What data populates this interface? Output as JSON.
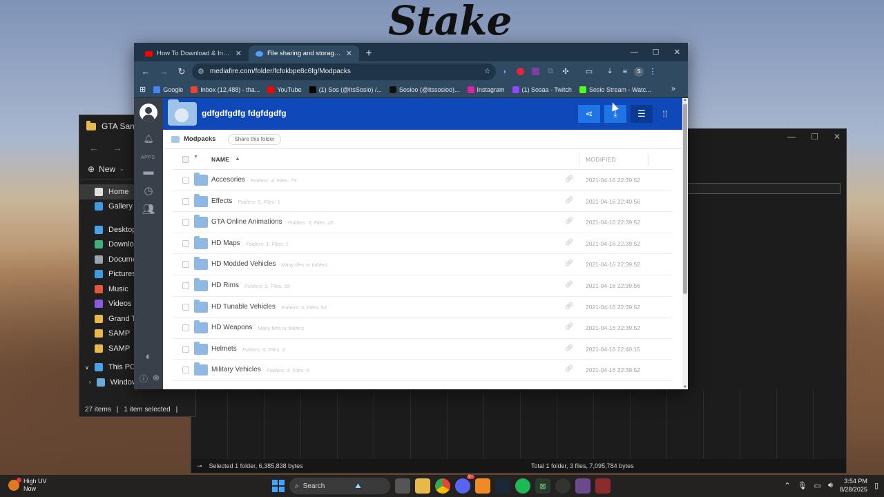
{
  "desktop": {
    "brand_logo": "Stake"
  },
  "explorer": {
    "title": "GTA San Andr",
    "new_label": "New",
    "nav_items": [
      {
        "label": "Home",
        "icon": "home-icon",
        "color": "#e0e0e0",
        "active": true
      },
      {
        "label": "Gallery",
        "icon": "gallery-icon",
        "color": "#3f9be0",
        "active": false
      },
      {
        "label": "Desktop",
        "icon": "desktop-icon",
        "color": "#4aa3e6",
        "active": false
      },
      {
        "label": "Downloads",
        "icon": "downloads-icon",
        "color": "#3fb07a",
        "active": false
      },
      {
        "label": "Documents",
        "icon": "documents-icon",
        "color": "#9aa4ad",
        "active": false
      },
      {
        "label": "Pictures",
        "icon": "pictures-icon",
        "color": "#3f9be0",
        "active": false
      },
      {
        "label": "Music",
        "icon": "music-icon",
        "color": "#e2563e",
        "active": false
      },
      {
        "label": "Videos",
        "icon": "videos-icon",
        "color": "#8a5be0",
        "active": false
      },
      {
        "label": "Grand Theft",
        "icon": "folder-icon",
        "color": "#e8b84a",
        "active": false
      },
      {
        "label": "SAMP",
        "icon": "folder-icon",
        "color": "#e8b84a",
        "active": false
      },
      {
        "label": "SAMP",
        "icon": "folder-icon",
        "color": "#e8b84a",
        "active": false
      }
    ],
    "this_pc": "This PC",
    "drive": "Windows (C:)",
    "status_items": "27 items",
    "status_selected": "1 item selected"
  },
  "darkapp": {
    "status_left": "Selected 1 folder, 6,385,838 bytes",
    "status_right": "Total 1 folder, 3 files, 7,095,784 bytes"
  },
  "browser": {
    "tabs": [
      {
        "label": "How To Download & Install Mods",
        "icon": "youtube-icon",
        "active": false
      },
      {
        "label": "File sharing and storage made simple",
        "icon": "mediafire-icon",
        "active": true
      }
    ],
    "url": "mediafire.com/folder/fcfokbpe8c6fg/Modpacks",
    "bookmarks": [
      {
        "label": "Google",
        "color": "#4285f4"
      },
      {
        "label": "Inbox (12,488) - tha...",
        "color": "#ea4335"
      },
      {
        "label": "YouTube",
        "color": "#ff0000"
      },
      {
        "label": "(1) Sos (@ItsSosio) /...",
        "color": "#000000"
      },
      {
        "label": "Sosioo (@itssosioo)...",
        "color": "#111111"
      },
      {
        "label": "Instagram",
        "color": "#d6249f"
      },
      {
        "label": "(1) Sosaa - Twitch",
        "color": "#9146ff"
      },
      {
        "label": "Sosio Stream - Watc...",
        "color": "#53fc18"
      }
    ]
  },
  "mediafire": {
    "folder_title": "gdfgdfgdfg fdgfdgdfg",
    "rail_apps_label": "APPS",
    "breadcrumb": "Modpacks",
    "share_folder": "Share this folder",
    "columns": {
      "name": "NAME",
      "modified": "MODIFIED"
    },
    "rows": [
      {
        "name": "Accesories",
        "meta": "Folders: 4, Files: 75",
        "date": "2021-04-16 22:39:52"
      },
      {
        "name": "Effects",
        "meta": "Folders: 0, Files: 1",
        "date": "2021-04-16 22:40:56"
      },
      {
        "name": "GTA Online Animations",
        "meta": "Folders: 3, Files: 26",
        "date": "2021-04-16 22:39:52"
      },
      {
        "name": "HD Maps",
        "meta": "Folders: 1, Files: 1",
        "date": "2021-04-16 22:39:52"
      },
      {
        "name": "HD Modded Vehicles",
        "meta": "Many files or folders",
        "date": "2021-04-16 22:39:52"
      },
      {
        "name": "HD Rims",
        "meta": "Folders: 1, Files: 39",
        "date": "2021-04-16 22:39:56"
      },
      {
        "name": "HD Tunable Vehicles",
        "meta": "Folders: 5, Files: 93",
        "date": "2021-04-16 22:39:52"
      },
      {
        "name": "HD Weapons",
        "meta": "Many files or folders",
        "date": "2021-04-16 22:39:52"
      },
      {
        "name": "Helmets",
        "meta": "Folders: 0, Files: 2",
        "date": "2021-04-16 22:40:15"
      },
      {
        "name": "Military Vehicles",
        "meta": "Folders: 4, Files: 8",
        "date": "2021-04-16 22:39:52"
      }
    ]
  },
  "taskbar": {
    "weather_title": "High UV",
    "weather_sub": "Now",
    "search_label": "Search",
    "badge": "9+",
    "time": "3:54 PM",
    "date": "8/28/2025"
  }
}
